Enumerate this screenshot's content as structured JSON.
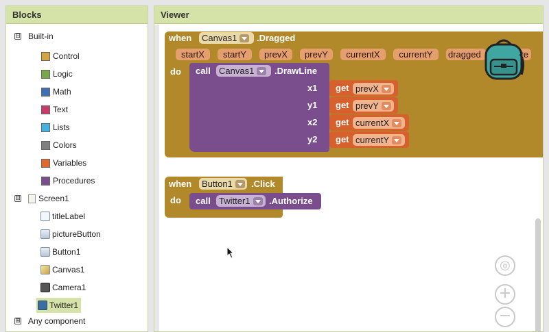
{
  "blocks_panel": {
    "title": "Blocks",
    "builtin_label": "Built-in",
    "builtin_toggle": "⊟",
    "builtin_items": [
      {
        "label": "Control",
        "color": "#d2a640"
      },
      {
        "label": "Logic",
        "color": "#78a84a"
      },
      {
        "label": "Math",
        "color": "#3f6fb5"
      },
      {
        "label": "Text",
        "color": "#c63c6a"
      },
      {
        "label": "Lists",
        "color": "#46b3dd"
      },
      {
        "label": "Colors",
        "color": "#808080"
      },
      {
        "label": "Variables",
        "color": "#e06a2d"
      },
      {
        "label": "Procedures",
        "color": "#7a4e8c"
      }
    ],
    "screen_label": "Screen1",
    "screen_toggle": "⊟",
    "components": [
      {
        "label": "titleLabel",
        "icon": "label-icon"
      },
      {
        "label": "pictureButton",
        "icon": "button-icon"
      },
      {
        "label": "Button1",
        "icon": "button-icon"
      },
      {
        "label": "Canvas1",
        "icon": "canvas-icon"
      },
      {
        "label": "Camera1",
        "icon": "camera-icon"
      },
      {
        "label": "Twitter1",
        "icon": "twitter-icon",
        "selected": true
      }
    ],
    "any_component_label": "Any component",
    "any_toggle": "⊞"
  },
  "viewer": {
    "title": "Viewer",
    "dragged_block": {
      "when": "when",
      "component": "Canvas1",
      "event": ".Dragged",
      "params": [
        "startX",
        "startY",
        "prevX",
        "prevY",
        "currentX",
        "currentY",
        "dragged",
        "te"
      ],
      "do": "do",
      "call": "call",
      "call_component": "Canvas1",
      "method": ".DrawLine",
      "args": [
        {
          "name": "x1",
          "get": "get",
          "var": "prevX"
        },
        {
          "name": "y1",
          "get": "get",
          "var": "prevY"
        },
        {
          "name": "x2",
          "get": "get",
          "var": "currentX"
        },
        {
          "name": "y2",
          "get": "get",
          "var": "currentY"
        }
      ]
    },
    "click_block": {
      "when": "when",
      "component": "Button1",
      "event": ".Click",
      "do": "do",
      "call": "call",
      "call_component": "Twitter1",
      "method": ".Authorize"
    },
    "zoom": {
      "center": "◎",
      "zoom_in": "+",
      "zoom_out": "−"
    },
    "backpack_color": "#3fa6a1"
  }
}
